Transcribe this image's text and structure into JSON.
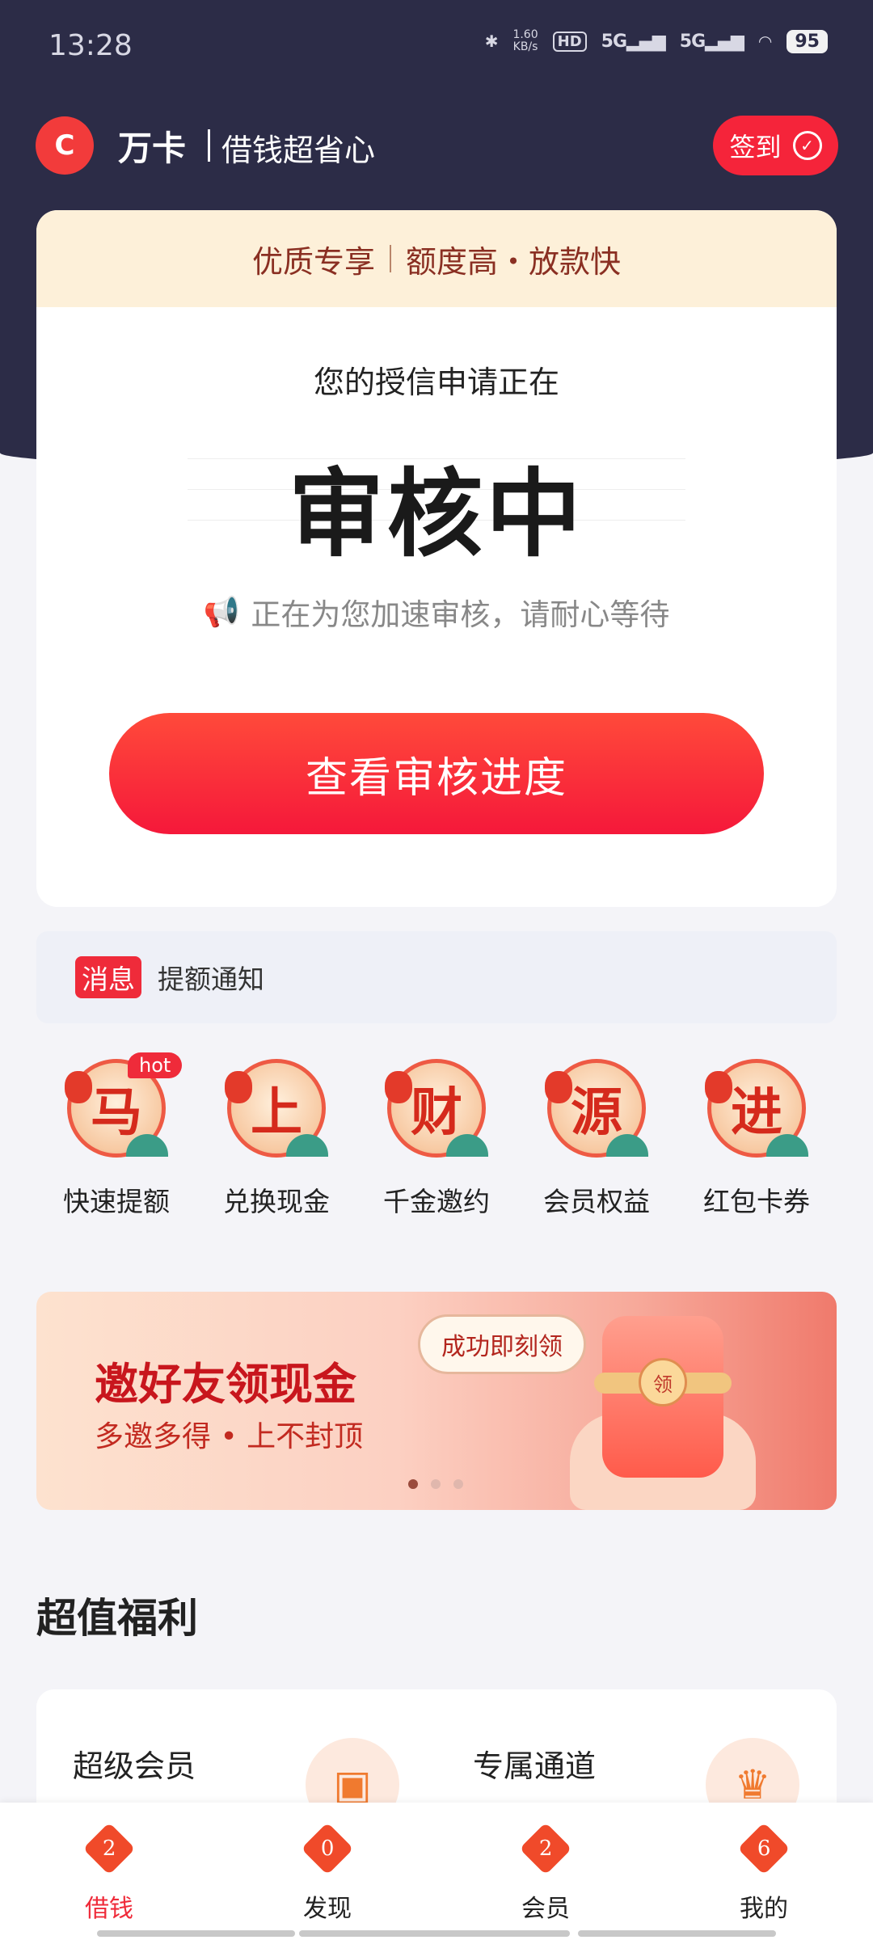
{
  "status_bar": {
    "time": "13:28",
    "net_speed_value": "1.60",
    "net_speed_unit": "KB/s",
    "hd": "HD",
    "signal_1": "5G",
    "signal_2": "5G",
    "battery": "95",
    "icons": [
      "bluetooth-icon",
      "signal-icon",
      "wifi-icon",
      "battery-icon"
    ]
  },
  "header": {
    "brand": "万卡",
    "slogan": "借钱超省心",
    "signin_label": "签到"
  },
  "main_card": {
    "banner_left": "优质专享",
    "banner_right": "额度高・放款快",
    "apply_text": "您的授信申请正在",
    "status": "审核中",
    "tip": "正在为您加速审核，请耐心等待",
    "button_label": "查看审核进度"
  },
  "notice": {
    "tag": "消息",
    "text": "提额通知"
  },
  "quick_entries": [
    {
      "glyph": "马",
      "label": "快速提额",
      "badge": "hot"
    },
    {
      "glyph": "上",
      "label": "兑换现金"
    },
    {
      "glyph": "财",
      "label": "千金邀约"
    },
    {
      "glyph": "源",
      "label": "会员权益"
    },
    {
      "glyph": "进",
      "label": "红包卡券"
    }
  ],
  "promo": {
    "title": "邀好友领现金",
    "subtitle": "多邀多得 • 上不封顶",
    "bubble": "成功即刻领",
    "seal": "领",
    "active_slide": 1,
    "slide_count": 3
  },
  "benefits": {
    "title": "超值福利",
    "items": [
      {
        "label": "超级会员",
        "icon": "vip-box-icon"
      },
      {
        "label": "专属通道",
        "icon": "crown-icon"
      }
    ]
  },
  "bottom_nav": [
    {
      "label": "借钱",
      "badge": "2",
      "active": true
    },
    {
      "label": "发现",
      "badge": "0",
      "active": false
    },
    {
      "label": "会员",
      "badge": "2",
      "active": false
    },
    {
      "label": "我的",
      "badge": "6",
      "active": false
    }
  ],
  "colors": {
    "header_bg": "#2c2c47",
    "accent_red": "#f5243a",
    "banner_bg": "#fdf0d9"
  }
}
